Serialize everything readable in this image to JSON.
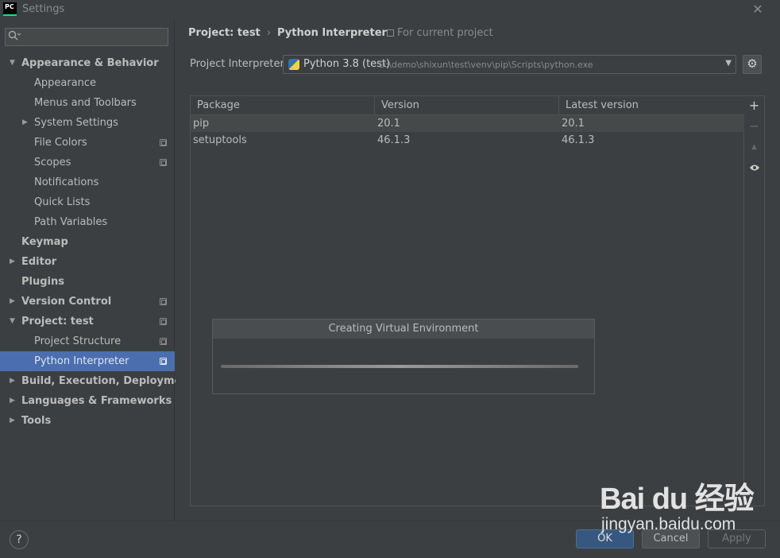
{
  "window": {
    "logo_text": "PC",
    "title": "Settings",
    "close_glyph": "✕"
  },
  "sidebar": {
    "search": {
      "placeholder": "",
      "value": "",
      "icon": "search-icon"
    },
    "items": [
      {
        "label": "Appearance & Behavior",
        "level": 0,
        "bold": true,
        "arrow": "▼",
        "copy": false
      },
      {
        "label": "Appearance",
        "level": 1,
        "bold": false,
        "arrow": "",
        "copy": false
      },
      {
        "label": "Menus and Toolbars",
        "level": 1,
        "bold": false,
        "arrow": "",
        "copy": false
      },
      {
        "label": "System Settings",
        "level": 1,
        "bold": false,
        "arrow": "▶",
        "copy": false
      },
      {
        "label": "File Colors",
        "level": 1,
        "bold": false,
        "arrow": "",
        "copy": true
      },
      {
        "label": "Scopes",
        "level": 1,
        "bold": false,
        "arrow": "",
        "copy": true
      },
      {
        "label": "Notifications",
        "level": 1,
        "bold": false,
        "arrow": "",
        "copy": false
      },
      {
        "label": "Quick Lists",
        "level": 1,
        "bold": false,
        "arrow": "",
        "copy": false
      },
      {
        "label": "Path Variables",
        "level": 1,
        "bold": false,
        "arrow": "",
        "copy": false
      },
      {
        "label": "Keymap",
        "level": 0,
        "bold": true,
        "arrow": "",
        "copy": false
      },
      {
        "label": "Editor",
        "level": 0,
        "bold": true,
        "arrow": "▶",
        "copy": false
      },
      {
        "label": "Plugins",
        "level": 0,
        "bold": true,
        "arrow": "",
        "copy": false
      },
      {
        "label": "Version Control",
        "level": 0,
        "bold": true,
        "arrow": "▶",
        "copy": true
      },
      {
        "label": "Project: test",
        "level": 0,
        "bold": true,
        "arrow": "▼",
        "copy": true
      },
      {
        "label": "Project Structure",
        "level": 1,
        "bold": false,
        "arrow": "",
        "copy": true
      },
      {
        "label": "Python Interpreter",
        "level": 1,
        "bold": false,
        "arrow": "",
        "copy": true,
        "selected": true
      },
      {
        "label": "Build, Execution, Deployment",
        "level": 0,
        "bold": true,
        "arrow": "▶",
        "copy": false
      },
      {
        "label": "Languages & Frameworks",
        "level": 0,
        "bold": true,
        "arrow": "▶",
        "copy": false
      },
      {
        "label": "Tools",
        "level": 0,
        "bold": true,
        "arrow": "▶",
        "copy": false
      }
    ]
  },
  "main": {
    "breadcrumb": {
      "parent": "Project: test",
      "separator": "›",
      "current": "Python Interpreter"
    },
    "scope_note": "For current project",
    "interpreter": {
      "label": "Project Interpreter:",
      "name": "Python 3.8 (test)",
      "path": "D:\\demo\\shixun\\test\\venv\\pip\\Scripts\\python.exe",
      "dropdown_glyph": "▼",
      "settings_glyph": "⚙"
    },
    "packages": {
      "columns": [
        "Package",
        "Version",
        "Latest version"
      ],
      "rows": [
        {
          "package": "pip",
          "version": "20.1",
          "latest": "20.1"
        },
        {
          "package": "setuptools",
          "version": "46.1.3",
          "latest": "46.1.3"
        }
      ],
      "tools": {
        "add": "+",
        "remove": "−",
        "upgrade": "▲",
        "show": "👁"
      }
    },
    "progress_dialog": {
      "title": "Creating Virtual Environment",
      "progress": 1.0
    }
  },
  "footer": {
    "help": "?",
    "ok": "OK",
    "cancel": "Cancel",
    "apply": "Apply"
  },
  "watermark": {
    "logo": "Bai du 经验",
    "url": "jingyan.baidu.com"
  },
  "colors": {
    "background": "#3c3f41",
    "selection": "#4b6eaf",
    "ok_button": "#365880"
  }
}
